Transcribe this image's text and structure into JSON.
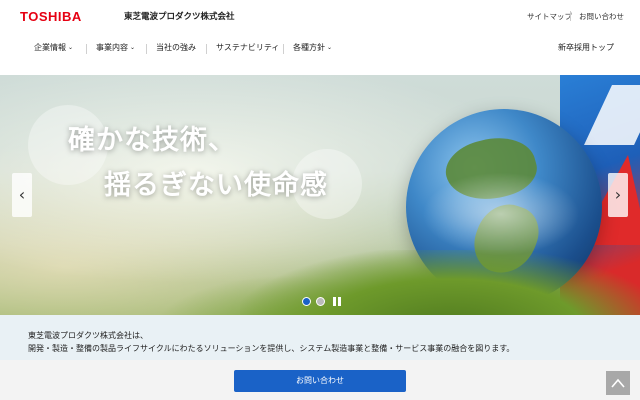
{
  "header": {
    "logo": "TOSHIBA",
    "company_name": "東芝電波プロダクツ株式会社",
    "utility": {
      "sitemap": "サイトマップ",
      "contact": "お問い合わせ"
    }
  },
  "nav": {
    "items": [
      {
        "label": "企業情報",
        "dropdown": "⌄"
      },
      {
        "label": "事業内容",
        "dropdown": "⌄"
      },
      {
        "label": "当社の強み"
      },
      {
        "label": "サステナビリティ"
      },
      {
        "label": "各種方針",
        "dropdown": "⌄"
      }
    ],
    "recruit": "新卒採用トップ"
  },
  "hero": {
    "headline_line1": "確かな技術、",
    "headline_line2": "揺るぎない使命感",
    "prev_arrow": "‹",
    "next_arrow": "›",
    "slide_count": 2,
    "active_slide": 1
  },
  "intro": {
    "line1": "東芝電波プロダクツ株式会社は、",
    "line2": "開発・製造・整備の製品ライフサイクルにわたるソリューションを提供し、システム製造事業と整備・サービス事業の融合を図ります。"
  },
  "cta": {
    "contact_button": "お問い合わせ"
  },
  "colors": {
    "brand_red": "#e60012",
    "accent_blue": "#1a62c7",
    "intro_bg": "#e9f1f5"
  },
  "icons": {
    "dropdown": "chevron-down-icon",
    "prev": "chevron-left-icon",
    "next": "chevron-right-icon",
    "pause": "pause-icon",
    "back_to_top": "chevron-up-icon"
  }
}
